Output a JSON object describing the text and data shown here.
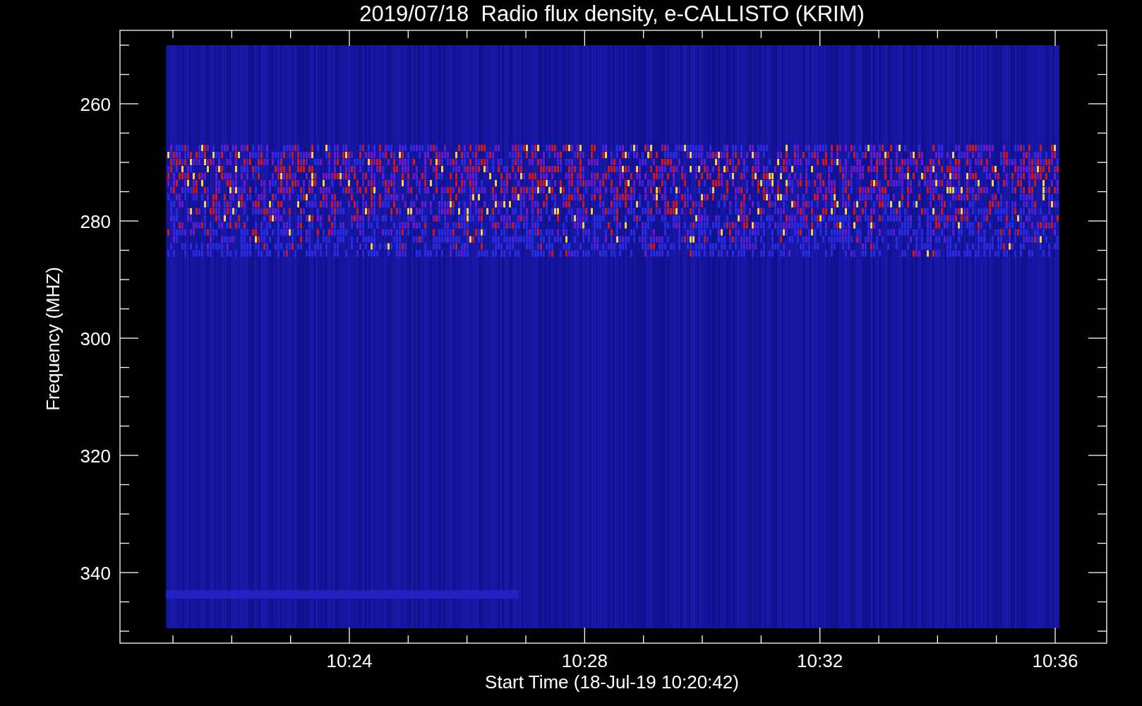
{
  "title": "2019/07/18  Radio flux density, e-CALLISTO (KRIM)",
  "y_axis": {
    "label": "Frequency (MHZ)",
    "ticks": [
      "260",
      "280",
      "300",
      "320",
      "340"
    ]
  },
  "x_axis": {
    "label": "Start Time (18-Jul-19 10:20:42)",
    "ticks": [
      "10:24",
      "10:28",
      "10:32",
      "10:36"
    ]
  }
}
